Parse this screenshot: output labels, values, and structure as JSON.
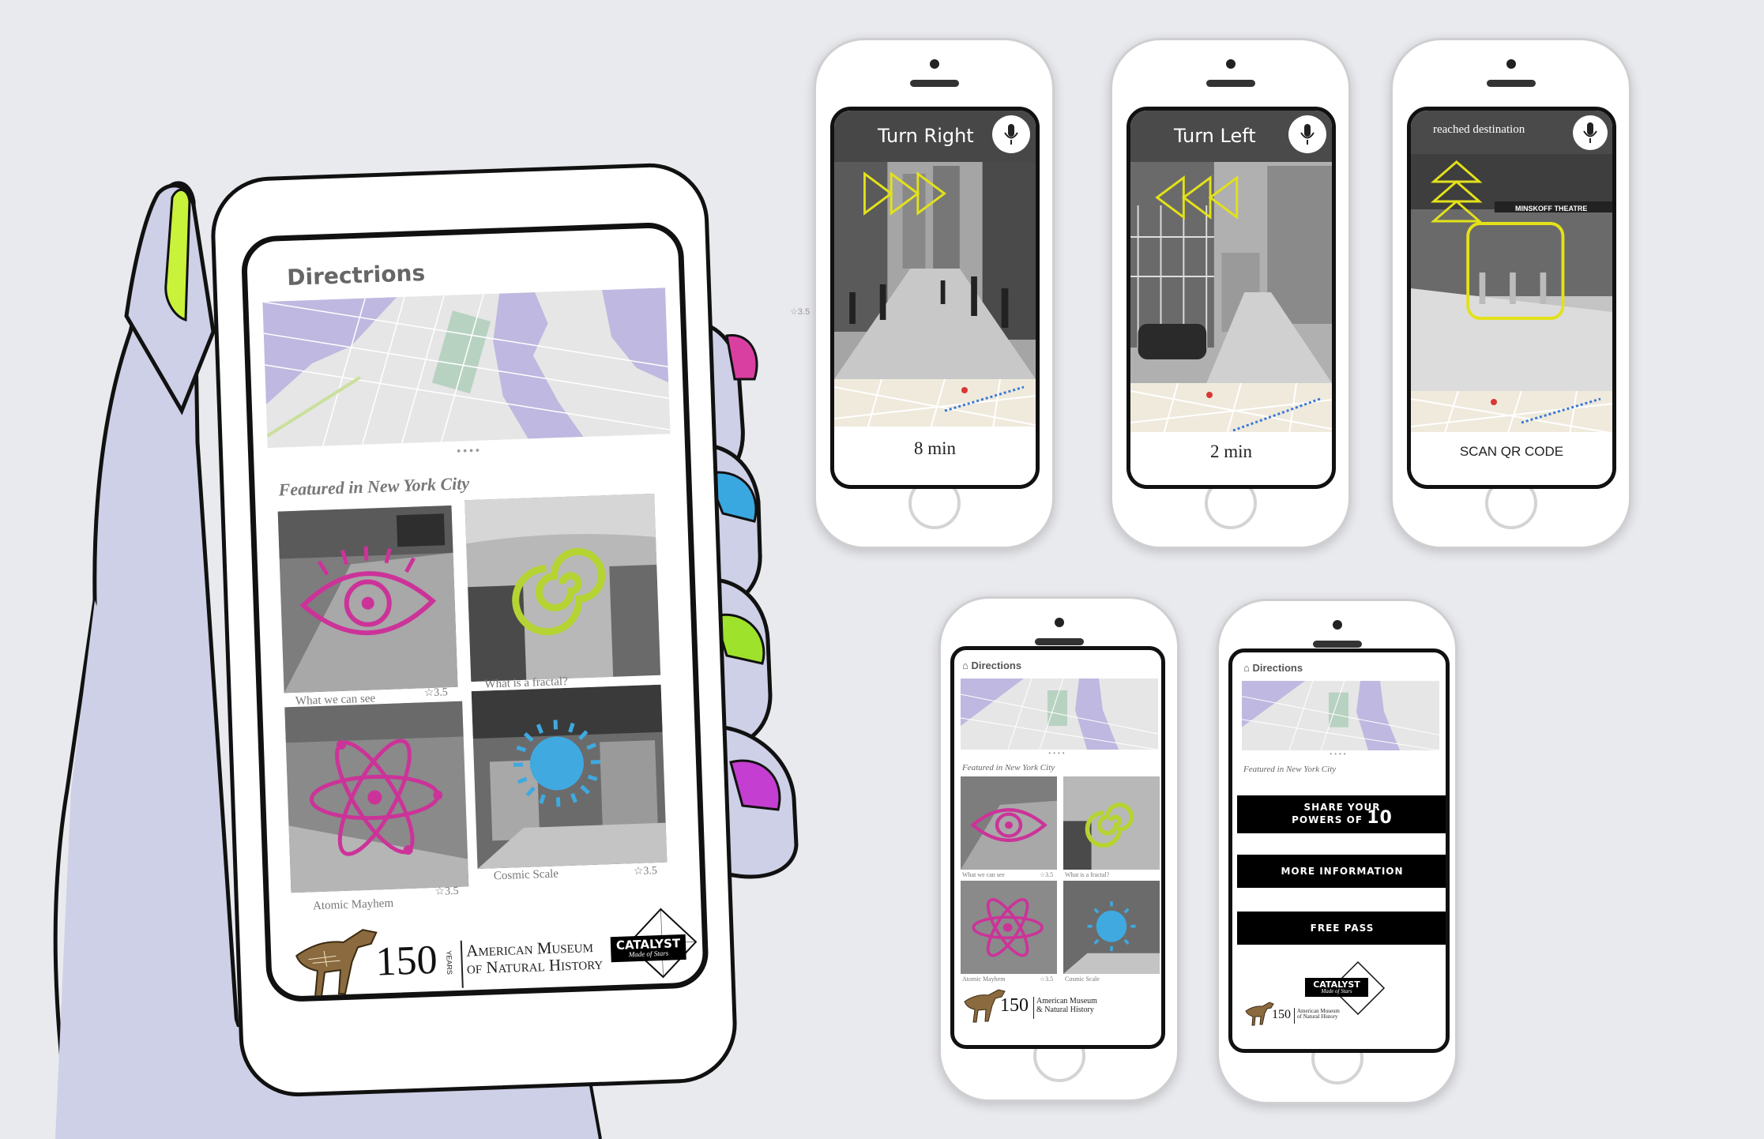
{
  "colors": {
    "magenta": "#cc3399",
    "lime": "#b5d433",
    "cyan": "#3fa9e0",
    "yellow_arrow": "#e3e11a",
    "hand": "#cdd0e6",
    "nail_lime": "#c9f23a",
    "nail_magenta": "#d93fa0",
    "nail_cyan": "#3aa8e0",
    "nail_green": "#9ee22b",
    "nail_purple": "#c43ed1",
    "map_water": "#bfb8e0",
    "map_park": "#b8d2c2"
  },
  "main_phone": {
    "title": "Directrions",
    "dots": "••••",
    "featured_title": "Featured in New York City",
    "tiles": [
      {
        "caption": "What we can see",
        "rating": "☆3.5",
        "icon": "eye-icon"
      },
      {
        "caption": "What is a fractal?",
        "rating": "",
        "icon": "spiral-icon"
      },
      {
        "caption": "Atomic Mayhem",
        "rating": "☆3.5",
        "icon": "atom-icon"
      },
      {
        "caption": "Cosmic Scale",
        "rating": "☆3.5",
        "icon": "sun-icon"
      }
    ],
    "logo": {
      "years": "150",
      "years_label": "YEARS",
      "museum_line1": "American Museum",
      "museum_line2": "of Natural History",
      "catalyst": "CATALYST",
      "catalyst_sub": "Made of Stars"
    }
  },
  "stray_label": "☆3.5",
  "nav_screens": [
    {
      "instruction": "Turn Right",
      "footer": "8 min",
      "arrow": "right-chevrons-icon"
    },
    {
      "instruction": "Turn Left",
      "footer": "2 min",
      "arrow": "left-chevrons-icon"
    },
    {
      "instruction": "reached destination",
      "footer": "SCAN QR CODE",
      "arrow": "up-chevrons-icon",
      "sign": "MINSKOFF THEATRE"
    }
  ],
  "small_home": {
    "title": "Directions",
    "dots": "••••",
    "featured_title": "Featured in New York City",
    "tiles": [
      {
        "caption": "What we can see",
        "rating": "☆3.5"
      },
      {
        "caption": "What is a fractal?",
        "rating": ""
      },
      {
        "caption": "Atomic Mayhem",
        "rating": "☆3.5"
      },
      {
        "caption": "Cosmic Scale",
        "rating": ""
      }
    ],
    "logo": {
      "years": "150",
      "museum_line1": "American Museum",
      "museum_line2": "& Natural History"
    }
  },
  "small_menu": {
    "title": "Directions",
    "dots": "••••",
    "featured_title": "Featured in New York City",
    "share_line1": "SHARE YOUR",
    "share_line2": "POWERS OF",
    "share_num": "10",
    "more_info": "MORE INFORMATION",
    "free_pass": "FREE PASS",
    "catalyst": "CATALYST",
    "catalyst_sub": "Made of Stars",
    "museum_line1": "American Museum",
    "museum_line2": "of Natural History"
  }
}
